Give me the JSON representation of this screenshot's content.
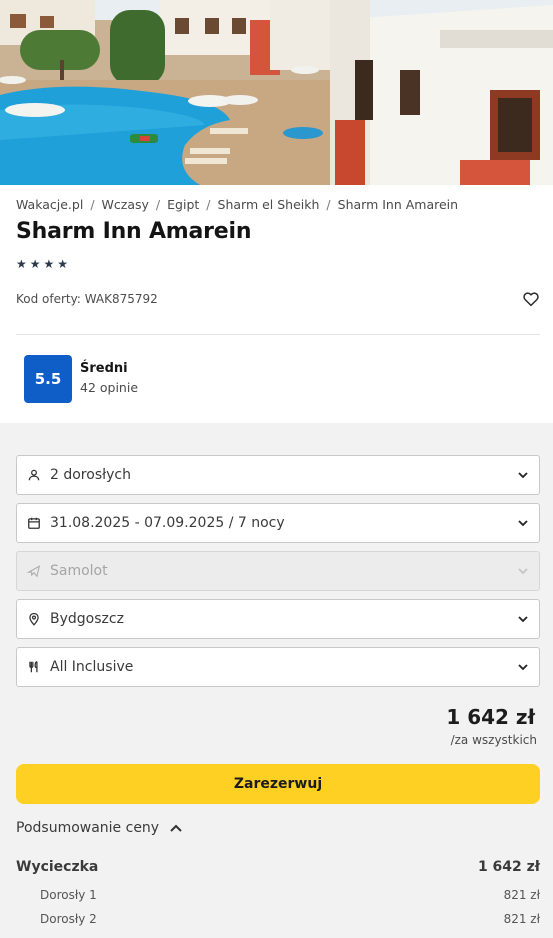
{
  "breadcrumb": [
    "Wakacje.pl",
    "Wczasy",
    "Egipt",
    "Sharm el Sheikh",
    "Sharm Inn Amarein"
  ],
  "hotel": {
    "name": "Sharm Inn Amarein",
    "stars": 4,
    "offer_code": "Kod oferty: WAK875792"
  },
  "rating": {
    "score": "5.5",
    "label": "Średni",
    "count": "42 opinie",
    "color": "#0f5ec8"
  },
  "fields": {
    "travelers": "2 dorosłych",
    "dates": "31.08.2025 - 07.09.2025 / 7 nocy",
    "transport": "Samolot",
    "departure": "Bydgoszcz",
    "board": "All Inclusive"
  },
  "price": {
    "total": "1 642 zł",
    "per": "/za wszystkich"
  },
  "book_label": "Zarezerwuj",
  "book_color": "#fed024",
  "summary": {
    "toggle_label": "Podsumowanie ceny",
    "trip_label": "Wycieczka",
    "trip_price": "1 642 zł",
    "items": [
      {
        "label": "Dorosły 1",
        "price": "821 zł"
      },
      {
        "label": "Dorosły 2",
        "price": "821 zł"
      }
    ]
  }
}
